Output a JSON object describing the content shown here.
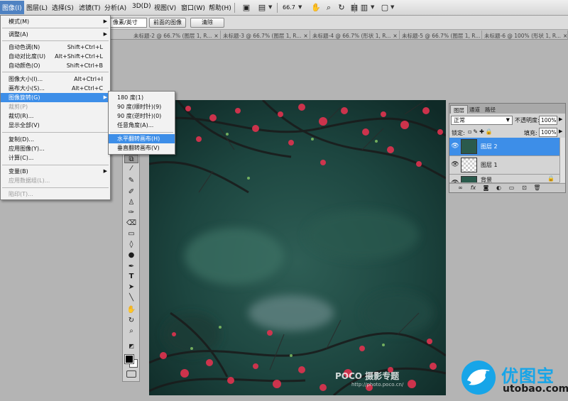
{
  "menubar": {
    "items": [
      "图像(I)",
      "图层(L)",
      "选择(S)",
      "滤镜(T)",
      "分析(A)",
      "3D(D)",
      "视图(V)",
      "窗口(W)",
      "帮助(H)"
    ],
    "active_index": 0,
    "zoom": "66.7"
  },
  "options_bar": {
    "unit_select": "像素/英寸",
    "front_image_button": "前面的图像",
    "clear_button": "清除"
  },
  "doc_tabs": [
    "未标题-2 @ 66.7% (图层 1, R...",
    "未标题-3 @ 66.7% (图层 1, R...",
    "未标题-4 @ 66.7% (形状 1, R...",
    "未标题-5 @ 66.7% (图层 1, R...",
    "未标题-6 @ 100% (形状 1, R..."
  ],
  "image_menu": {
    "mode": "模式(M)",
    "adjust": "调整(A)",
    "auto_tone": "自动色调(N)",
    "auto_tone_sc": "Shift+Ctrl+L",
    "auto_contrast": "自动对比度(U)",
    "auto_contrast_sc": "Alt+Shift+Ctrl+L",
    "auto_color": "自动颜色(O)",
    "auto_color_sc": "Shift+Ctrl+B",
    "image_size": "图像大小(I)...",
    "image_size_sc": "Alt+Ctrl+I",
    "canvas_size": "画布大小(S)...",
    "canvas_size_sc": "Alt+Ctrl+C",
    "rotate": "图像旋转(G)",
    "crop": "裁剪(P)",
    "trim": "裁切(R)...",
    "reveal_all": "显示全部(V)",
    "duplicate": "复制(D)...",
    "apply_image": "应用图像(Y)...",
    "calculations": "计算(C)...",
    "variables": "变量(B)",
    "apply_dataset": "应用数据组(L)...",
    "trap": "陷印(T)..."
  },
  "rotate_submenu": {
    "r180": "180 度(1)",
    "r90cw": "90 度(顺时针)(9)",
    "r90ccw": "90 度(逆时针)(0)",
    "arbitrary": "任意角度(A)...",
    "flip_h": "水平翻转画布(H)",
    "flip_v": "垂直翻转画布(V)"
  },
  "tools": [
    "crop-tool",
    "eyedropper-tool",
    "healing-brush-tool",
    "brush-tool",
    "clone-stamp-tool",
    "history-brush-tool",
    "eraser-tool",
    "gradient-tool",
    "blur-tool",
    "dodge-tool",
    "pen-tool",
    "type-tool",
    "path-selection-tool",
    "line-tool",
    "hand-tool",
    "rotate-view-tool",
    "zoom-tool"
  ],
  "colors": {
    "foreground": "#000000",
    "background": "#ffffff",
    "highlight": "#3d8ee8",
    "logo_blue": "#17a5e8"
  },
  "layers_panel": {
    "tabs": [
      "图层",
      "通道",
      "路径"
    ],
    "blend_mode": "正常",
    "opacity_label": "不透明度:",
    "opacity_value": "100%",
    "lock_label": "锁定:",
    "fill_label": "填充:",
    "fill_value": "100%",
    "layers": [
      {
        "name": "图层 2",
        "selected": true
      },
      {
        "name": "图层 1",
        "selected": false
      },
      {
        "name": "背景",
        "selected": false
      }
    ]
  },
  "watermark": {
    "text": "POCO 摄影专题",
    "url": "http://photo.poco.cn/"
  },
  "logo": {
    "cn": "优图宝",
    "en": "utobao.com"
  }
}
